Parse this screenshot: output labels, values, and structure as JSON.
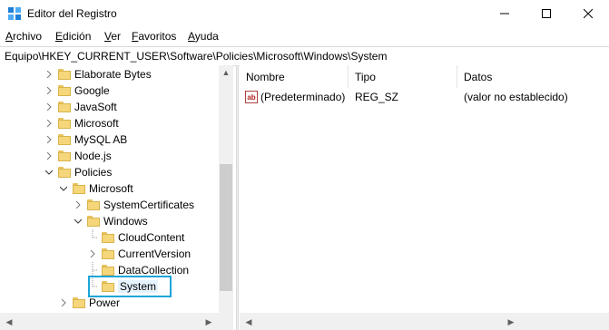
{
  "window": {
    "title": "Editor del Registro"
  },
  "menu": [
    {
      "label": "Archivo",
      "u": "A",
      "rest": "rchivo"
    },
    {
      "label": "Edición",
      "u": "E",
      "rest": "dición"
    },
    {
      "label": "Ver",
      "u": "V",
      "rest": "er"
    },
    {
      "label": "Favoritos",
      "u": "F",
      "rest": "avoritos"
    },
    {
      "label": "Ayuda",
      "u": "A",
      "rest": "yuda"
    }
  ],
  "address": "Equipo\\HKEY_CURRENT_USER\\Software\\Policies\\Microsoft\\Windows\\System",
  "tree": [
    {
      "label": "Elaborate Bytes",
      "expander": "collapsed"
    },
    {
      "label": "Google",
      "expander": "collapsed"
    },
    {
      "label": "JavaSoft",
      "expander": "collapsed"
    },
    {
      "label": "Microsoft",
      "expander": "collapsed"
    },
    {
      "label": "MySQL AB",
      "expander": "collapsed"
    },
    {
      "label": "Node.js",
      "expander": "collapsed"
    },
    {
      "label": "Policies",
      "expander": "expanded"
    },
    {
      "label": "Microsoft",
      "expander": "expanded"
    },
    {
      "label": "SystemCertificates",
      "expander": "collapsed"
    },
    {
      "label": "Windows",
      "expander": "expanded"
    },
    {
      "label": "CloudContent",
      "expander": "none"
    },
    {
      "label": "CurrentVersion",
      "expander": "collapsed"
    },
    {
      "label": "DataCollection",
      "expander": "none"
    },
    {
      "label": "System",
      "expander": "none",
      "selected": true
    },
    {
      "label": "Power",
      "expander": "collapsed"
    }
  ],
  "list": {
    "columns": [
      "Nombre",
      "Tipo",
      "Datos"
    ],
    "rows": [
      {
        "icon": "string-value-icon",
        "name": "(Predeterminado)",
        "type": "REG_SZ",
        "data": "(valor no establecido)"
      }
    ]
  }
}
